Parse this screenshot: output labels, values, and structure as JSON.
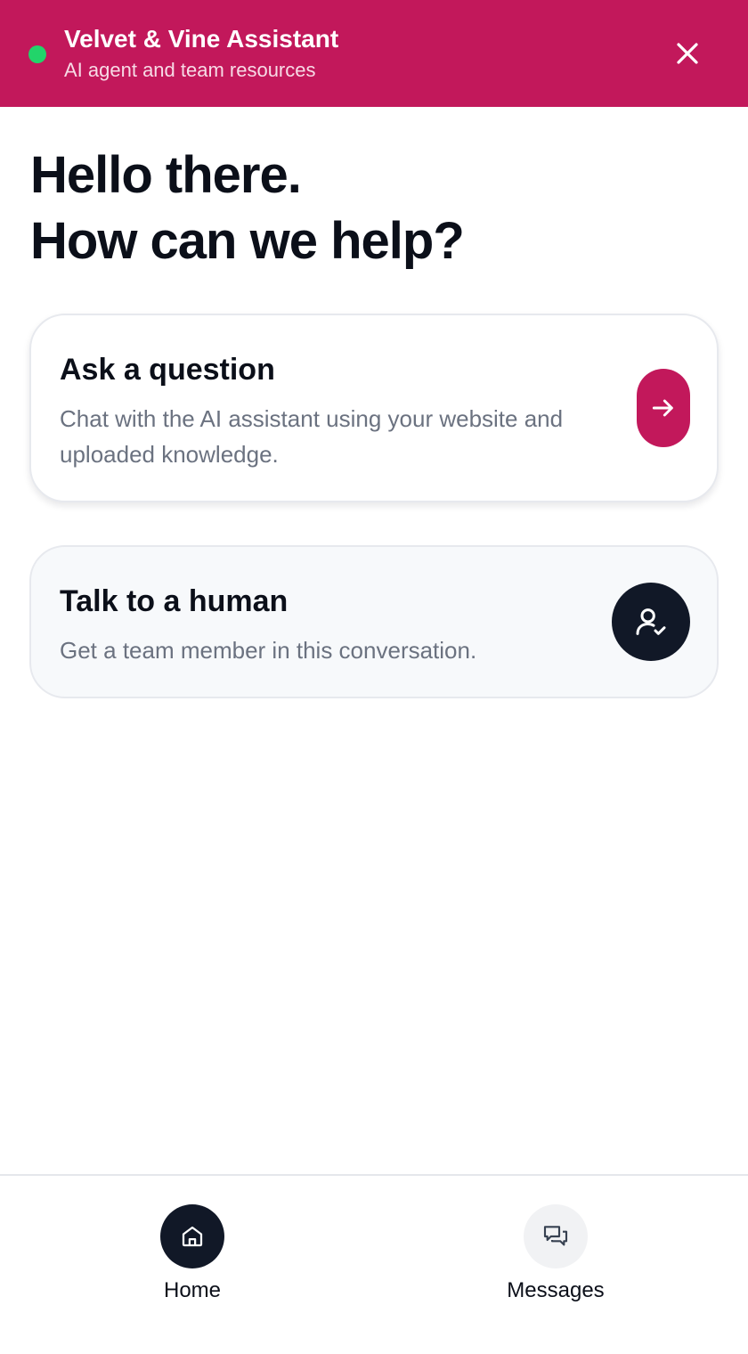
{
  "header": {
    "title": "Velvet & Vine Assistant",
    "subtitle": "AI agent and team resources",
    "status_icon": "online-status-dot",
    "close_icon": "close-icon"
  },
  "greeting": {
    "line1": "Hello there.",
    "line2": "How can we help?"
  },
  "cards": {
    "ask": {
      "title": "Ask a question",
      "description": "Chat with the AI assistant using your website and uploaded knowledge.",
      "icon": "arrow-right-icon"
    },
    "human": {
      "title": "Talk to a human",
      "description": "Get a team member in this conversation.",
      "icon": "user-check-icon"
    }
  },
  "nav": {
    "home": {
      "label": "Home",
      "icon": "home-icon",
      "active": true
    },
    "messages": {
      "label": "Messages",
      "icon": "messages-icon",
      "active": false
    }
  },
  "colors": {
    "brand": "#c2185b",
    "status_online": "#22d46a",
    "dark": "#111827",
    "muted_text": "#6b7280"
  }
}
